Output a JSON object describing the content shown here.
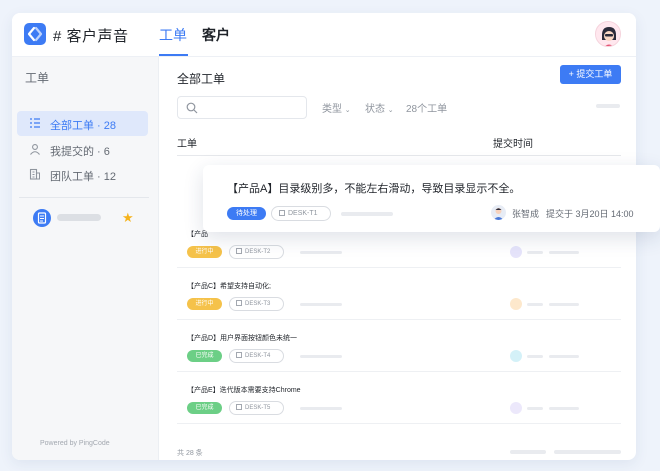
{
  "header": {
    "app_title": "# 客户声音",
    "tabs": [
      {
        "label": "工单",
        "active": true
      },
      {
        "label": "客户",
        "active": false
      }
    ]
  },
  "sidebar": {
    "title": "工单",
    "items": [
      {
        "label": "全部工单 · 28",
        "icon": "list-icon",
        "active": true
      },
      {
        "label": "我提交的 · 6",
        "icon": "user-icon",
        "active": false
      },
      {
        "label": "团队工单 · 12",
        "icon": "building-icon",
        "active": false
      }
    ],
    "space_icon": "document-icon",
    "favorite_icon": "star-icon",
    "powered_by": "Powered by PingCode"
  },
  "main": {
    "title": "全部工单",
    "submit_label": "+ 提交工单",
    "search_placeholder": "",
    "filters": {
      "type": "类型",
      "status": "状态",
      "count": "28个工单"
    },
    "columns": {
      "ticket": "工单",
      "time": "提交时间"
    },
    "rows": [
      {
        "title": "【产品",
        "status": "进行中",
        "status_color": "#f5c24a",
        "code": "DESK-T2",
        "dot_color": "#e6e4fb"
      },
      {
        "title": "【产品C】希望支持自动化;",
        "status": "进行中",
        "status_color": "#f5c24a",
        "code": "DESK-T3",
        "dot_color": "#fde8cc"
      },
      {
        "title": "【产品D】用户界面按钮颜色未统一",
        "status": "已完成",
        "status_color": "#6ccf86",
        "code": "DESK-T4",
        "dot_color": "#d4f1f8"
      },
      {
        "title": "【产品E】迭代版本需要支持Chrome",
        "status": "已完成",
        "status_color": "#6ccf86",
        "code": "DESK-T5",
        "dot_color": "#ece8fb"
      }
    ],
    "footer_text": "共 28 条"
  },
  "detail_card": {
    "title": "【产品A】目录级别多，不能左右滑动，导致目录显示不全。",
    "status": "待处理",
    "code": "DESK-T1",
    "user": "张智成",
    "submitted": "提交于 3月20日 14:00"
  },
  "colors": {
    "accent": "#3d7bf4",
    "in_progress": "#f5c24a",
    "done": "#6ccf86"
  }
}
